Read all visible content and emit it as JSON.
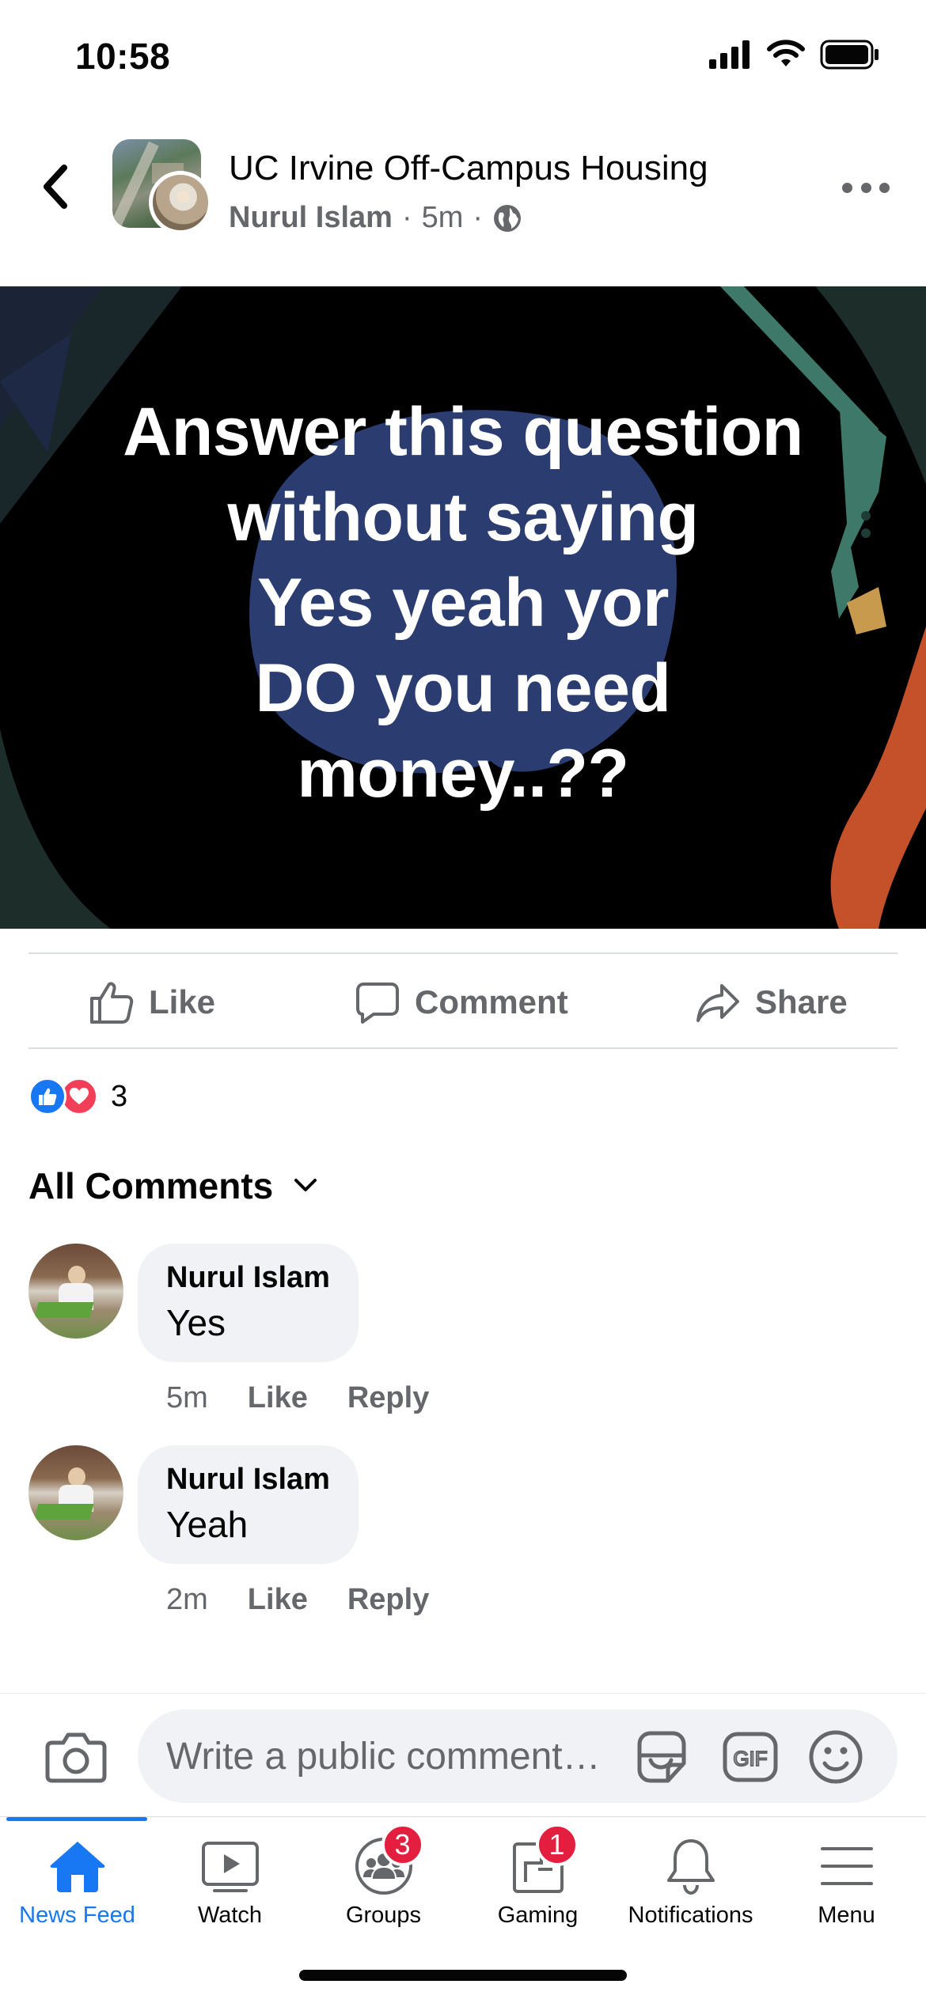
{
  "status_bar": {
    "time": "10:58"
  },
  "header": {
    "group_name": "UC Irvine Off-Campus Housing",
    "author": "Nurul Islam",
    "time_ago": "5m",
    "separator": "·"
  },
  "post": {
    "lines": [
      "Answer this question",
      "without saying",
      "Yes yeah yor",
      "DO you need",
      "money..??"
    ]
  },
  "actions": {
    "like": "Like",
    "comment": "Comment",
    "share": "Share"
  },
  "reactions": {
    "count": "3"
  },
  "comments_filter": {
    "label": "All Comments"
  },
  "comments": [
    {
      "author": "Nurul Islam",
      "text": "Yes",
      "time": "5m",
      "like": "Like",
      "reply": "Reply"
    },
    {
      "author": "Nurul Islam",
      "text": "Yeah",
      "time": "2m",
      "like": "Like",
      "reply": "Reply"
    }
  ],
  "composer": {
    "placeholder": "Write a public comment…",
    "gif": "GIF"
  },
  "tabs": [
    {
      "label": "News Feed",
      "active": true
    },
    {
      "label": "Watch"
    },
    {
      "label": "Groups",
      "badge": "3"
    },
    {
      "label": "Gaming",
      "badge": "1"
    },
    {
      "label": "Notifications"
    },
    {
      "label": "Menu"
    }
  ],
  "colors": {
    "accent": "#1877f2",
    "badge": "#e41e3f",
    "secondary_text": "#65676b",
    "bubble": "#f0f2f5"
  }
}
